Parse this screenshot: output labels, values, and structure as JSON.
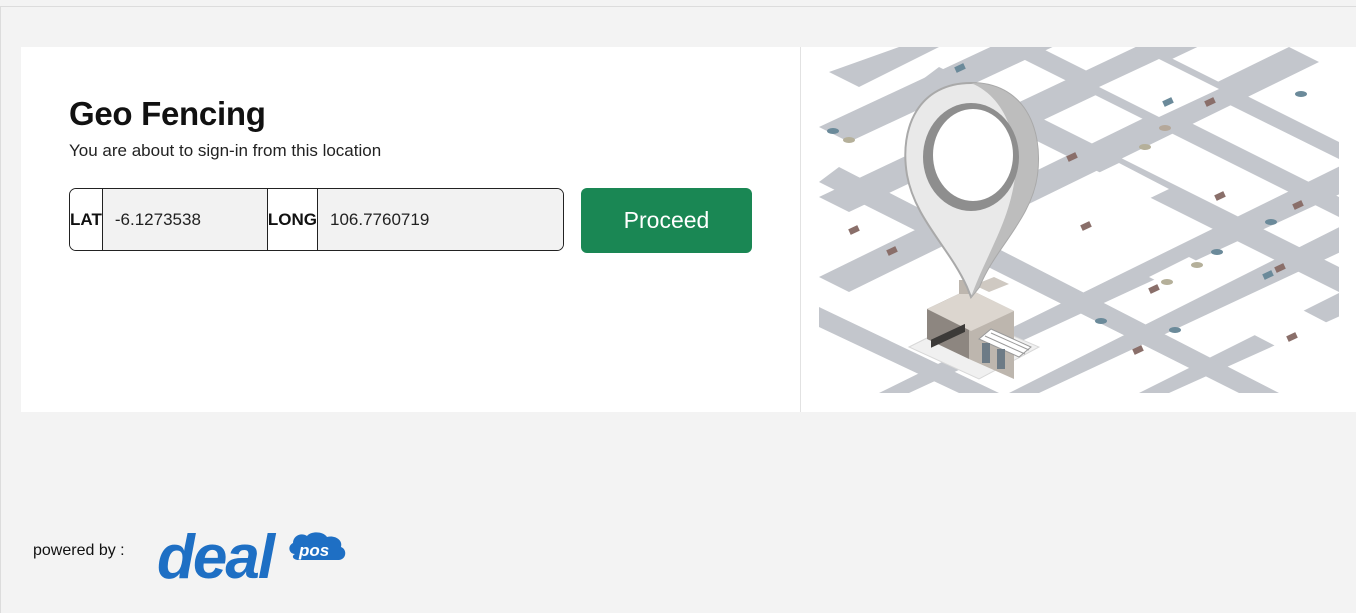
{
  "page": {
    "title": "Geo Fencing",
    "subtitle": "You are about to sign-in from this location"
  },
  "coordinates": {
    "lat_label": "LAT",
    "lat_value": "-6.1273538",
    "long_label": "LONG",
    "long_value": "106.7760719"
  },
  "actions": {
    "proceed_label": "Proceed"
  },
  "footer": {
    "powered_by": "powered by :",
    "logo_word": "deal",
    "logo_badge": "pos"
  },
  "colors": {
    "primary_button": "#1a8754",
    "logo_blue": "#1e6fc4",
    "map_roads": "#c3c6cc"
  },
  "icons": {
    "map_illustration": "location-pin-over-city-map"
  }
}
